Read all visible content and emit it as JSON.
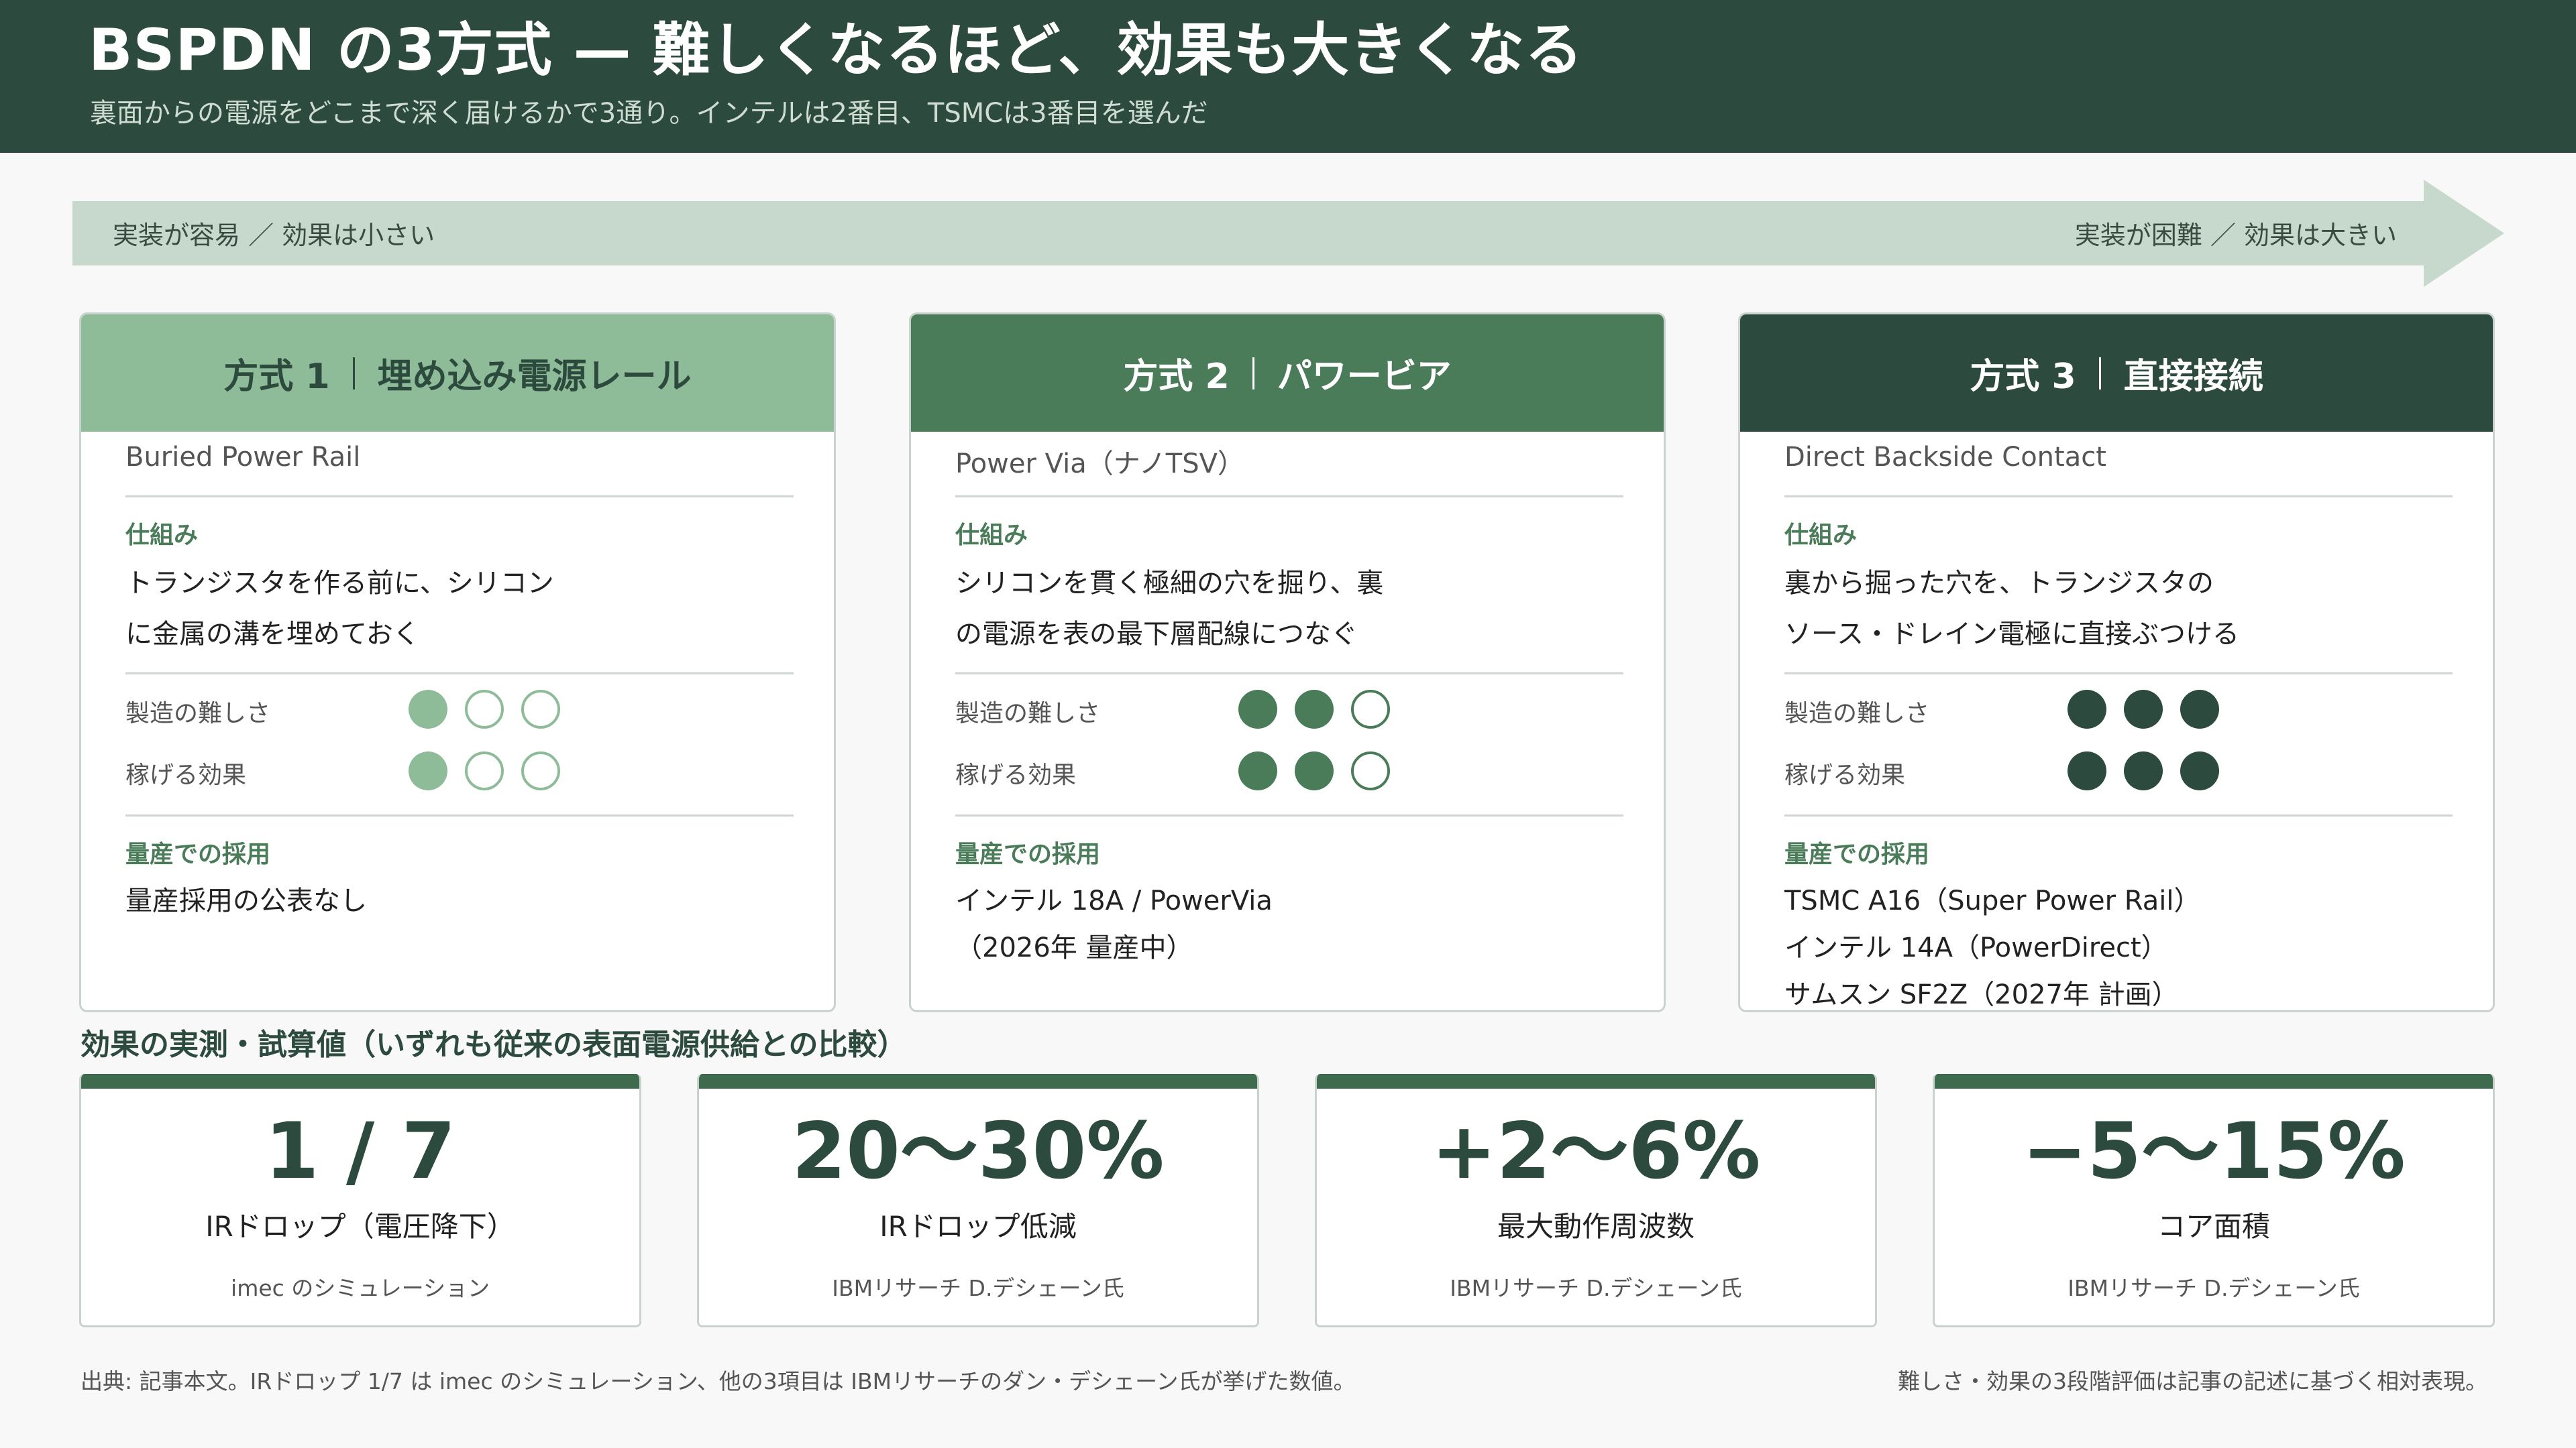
{
  "header": {
    "title": "BSPDN の3方式 — 難しくなるほど、効果も大きくなる",
    "subtitle": "裏面からの電源をどこまで深く届けるかで3通り。インテルは2番目、TSMCは3番目を選んだ"
  },
  "arrow": {
    "left_label": "実装が容易 ／ 効果は小さい",
    "right_label": "実装が困難 ／ 効果は大きい"
  },
  "cards": [
    {
      "number": "方式 1",
      "name": "埋め込み電源レール",
      "english": "Buried Power Rail",
      "mechanism_label": "仕組み",
      "mechanism_line1": "トランジスタを作る前に、シリコン",
      "mechanism_line2": "に金属の溝を埋めておく",
      "difficulty_label": "製造の難しさ",
      "difficulty": 1,
      "effect_label": "稼げる効果",
      "effect": 1,
      "adoption_label": "量産での採用",
      "adoption": [
        "量産採用の公表なし"
      ],
      "color": "#8fbc98"
    },
    {
      "number": "方式 2",
      "name": "パワービア",
      "english": "Power Via（ナノTSV）",
      "mechanism_label": "仕組み",
      "mechanism_line1": "シリコンを貫く極細の穴を掘り、裏",
      "mechanism_line2": "の電源を表の最下層配線につなぐ",
      "difficulty_label": "製造の難しさ",
      "difficulty": 2,
      "effect_label": "稼げる効果",
      "effect": 2,
      "adoption_label": "量産での採用",
      "adoption": [
        "インテル 18A / PowerVia",
        "（2026年 量産中）"
      ],
      "color": "#4b7c59"
    },
    {
      "number": "方式 3",
      "name": "直接接続",
      "english": "Direct Backside Contact",
      "mechanism_label": "仕組み",
      "mechanism_line1": "裏から掘った穴を、トランジスタの",
      "mechanism_line2": "ソース・ドレイン電極に直接ぶつける",
      "difficulty_label": "製造の難しさ",
      "difficulty": 3,
      "effect_label": "稼げる効果",
      "effect": 3,
      "adoption_label": "量産での採用",
      "adoption": [
        "TSMC A16（Super Power Rail）",
        "インテル 14A（PowerDirect）",
        "サムスン SF2Z（2027年 計画）"
      ],
      "color": "#2c4a3d"
    }
  ],
  "stats_title": "効果の実測・試算値（いずれも従来の表面電源供給との比較）",
  "stats": [
    {
      "value": "1 / 7",
      "label": "IRドロップ（電圧降下）",
      "source": "imec のシミュレーション"
    },
    {
      "value": "20〜30%",
      "label": "IRドロップ低減",
      "source": "IBMリサーチ D.デシェーン氏"
    },
    {
      "value": "+2〜6%",
      "label": "最大動作周波数",
      "source": "IBMリサーチ D.デシェーン氏"
    },
    {
      "value": "−5〜15%",
      "label": "コア面積",
      "source": "IBMリサーチ D.デシェーン氏"
    }
  ],
  "footer": {
    "left": "出典: 記事本文。IRドロップ 1/7 は imec のシミュレーション、他の3項目は IBMリサーチのダン・デシェーン氏が挙げた数値。",
    "right": "難しさ・効果の3段階評価は記事の記述に基づく相対表現。"
  }
}
